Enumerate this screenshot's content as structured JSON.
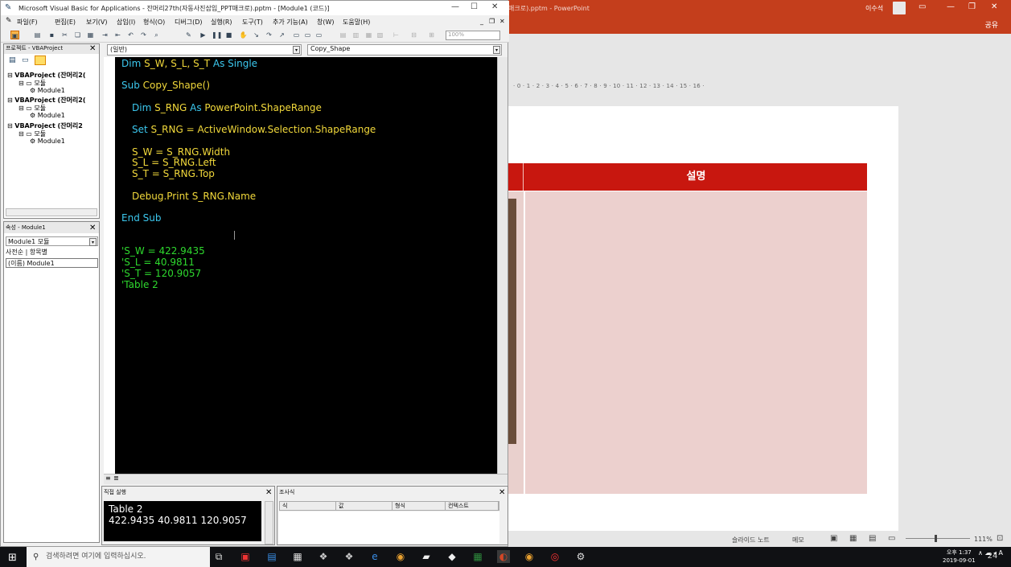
{
  "vba": {
    "title": "Microsoft Visual Basic for Applications - 잔머리27th(자동사진삽입_PPT매크로).pptm - [Module1 (코드)]",
    "menu": [
      "파일(F)",
      "편집(E)",
      "보기(V)",
      "삽입(I)",
      "형식(O)",
      "디버그(D)",
      "실행(R)",
      "도구(T)",
      "추가 기능(A)",
      "창(W)",
      "도움말(H)"
    ],
    "zoom": "100%",
    "project": {
      "header": "프로젝트 - VBAProject",
      "nodes": [
        {
          "project": "VBAProject (잔머리2(",
          "folder": "모듈",
          "module": "Module1"
        },
        {
          "project": "VBAProject (잔머리2(",
          "folder": "모듈",
          "module": "Module1"
        },
        {
          "project": "VBAProject (잔머리2",
          "folder": "모듈",
          "module": "Module1"
        }
      ]
    },
    "properties": {
      "header": "속성 - Module1",
      "object": "Module1 모듈",
      "tab_alpha": "사전순",
      "tab_cat": "항목별",
      "row": "(이름) Module1"
    },
    "code": {
      "object_combo": "(일반)",
      "proc_combo": "Copy_Shape",
      "lines": [
        {
          "kw": "Dim ",
          "tx": "S_W, S_L, S_T ",
          "kw2": "As Single"
        },
        {
          "kw": "Sub ",
          "tx": "Copy_Shape()"
        },
        {
          "kw": "Dim ",
          "tx": "S_RNG ",
          "kw2": "As ",
          "tx2": "PowerPoint.ShapeRange"
        },
        {
          "kw": "Set ",
          "tx": "S_RNG = ActiveWindow.Selection.ShapeRange"
        },
        {
          "tx": "S_W = S_RNG.Width"
        },
        {
          "tx": "S_L = S_RNG.Left"
        },
        {
          "tx": "S_T = S_RNG.Top"
        },
        {
          "tx": "Debug.Print S_RNG.Name"
        },
        {
          "kw": "End Sub"
        }
      ],
      "comments": [
        "'S_W = 422.9435",
        "'S_L = 40.9811",
        "'S_T = 120.9057",
        "'Table 2"
      ]
    },
    "immediate": {
      "header": "직접 실행",
      "lines": [
        "Table 2",
        "422.9435 40.9811 120.9057"
      ]
    },
    "watch": {
      "header": "조사식",
      "columns": [
        "식",
        "값",
        "형식",
        "컨텍스트"
      ]
    }
  },
  "ppt": {
    "title_fragment": "매크로).pptm - PowerPoint",
    "user": "이수석",
    "share": "공유",
    "ruler": "· 0 · 1 · 2 · 3 · 4 · 5 · 6 · 7 · 8 · 9 · 10 · 11 · 12 · 13 · 14 · 15 · 16 ·",
    "table_header": "설명",
    "status": {
      "notes": "슬라이드 노트",
      "comments": "메모",
      "zoom": "111%"
    },
    "colors": {
      "titlebar": "#c43e1c",
      "table_header": "#c8170f",
      "table_body": "#ecd0ce"
    }
  },
  "taskbar": {
    "search_placeholder": "검색하려면 여기에 입력하십시오.",
    "time": "오후 1:37",
    "date": "2019-09-01",
    "notifications": "24",
    "ime": "A"
  }
}
